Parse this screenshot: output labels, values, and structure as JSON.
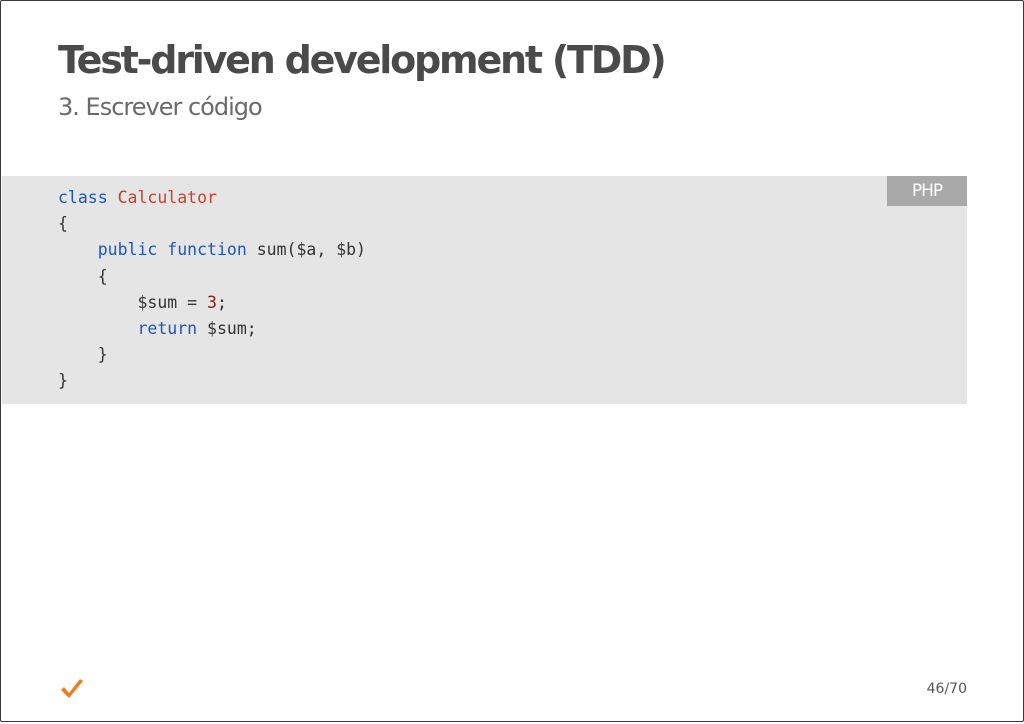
{
  "slide": {
    "title": "Test-driven development (TDD)",
    "subtitle": "3. Escrever código",
    "page_number": "46/70"
  },
  "code": {
    "language": "PHP",
    "lines": {
      "l1": {
        "k1": "class",
        "c1": "Calculator"
      },
      "l2": {
        "t1": "{"
      },
      "l3": {
        "indent": "    ",
        "k1": "public",
        "k2": "function",
        "t1": "sum($a, $b)"
      },
      "l4": {
        "indent": "    ",
        "t1": "{"
      },
      "l5": {
        "indent": "        ",
        "t1": "$sum = ",
        "n1": "3",
        "t2": ";"
      },
      "l6": {
        "indent": "        ",
        "k1": "return",
        "t1": "$sum;"
      },
      "l7": {
        "indent": "    ",
        "t1": "}"
      },
      "l8": {
        "t1": "}"
      }
    }
  },
  "icons": {
    "footer": "checkmark-icon"
  },
  "colors": {
    "keyword": "#1c57b5",
    "class_name": "#c6432f",
    "number": "#8b1a1a",
    "code_background": "#e5e5e5",
    "badge_background": "#a9a9a9",
    "check": "#f07c1e"
  }
}
